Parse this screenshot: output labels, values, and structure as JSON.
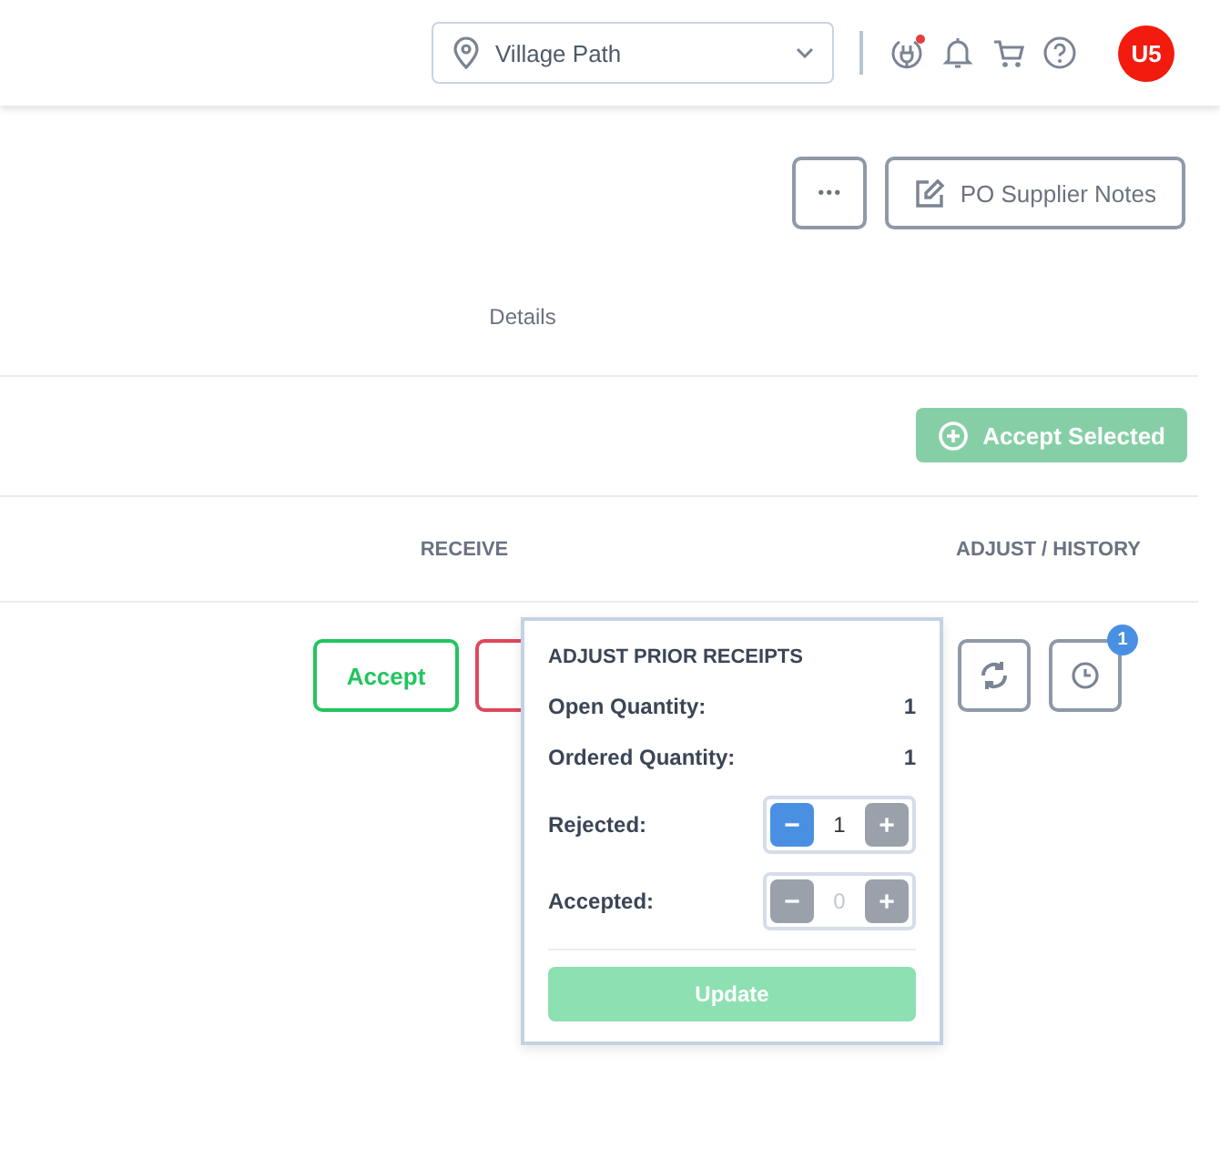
{
  "header": {
    "location": {
      "value": "Village Path"
    },
    "notification_dot": true,
    "avatar": "U5"
  },
  "toolbar": {
    "more": "•••",
    "notes_button": "PO Supplier Notes"
  },
  "details_label": "Details",
  "accept_selected": {
    "label": "Accept Selected",
    "disabled": true
  },
  "columns": [
    "RECEIVE",
    "ADJUST / HISTORY"
  ],
  "row": {
    "accept": "Accept",
    "history_badge": "1"
  },
  "popover": {
    "title": "ADJUST PRIOR RECEIPTS",
    "info": [
      {
        "label": "Open Quantity:",
        "value": "1"
      },
      {
        "label": "Ordered Quantity:",
        "value": "1"
      }
    ],
    "steppers": [
      {
        "label": "Rejected:",
        "value": "1",
        "minus": "−",
        "plus": "+",
        "minus_enabled": true
      },
      {
        "label": "Accepted:",
        "value": "0",
        "minus": "−",
        "plus": "+",
        "minus_enabled": false
      }
    ],
    "update": {
      "label": "Update",
      "disabled": true
    }
  }
}
